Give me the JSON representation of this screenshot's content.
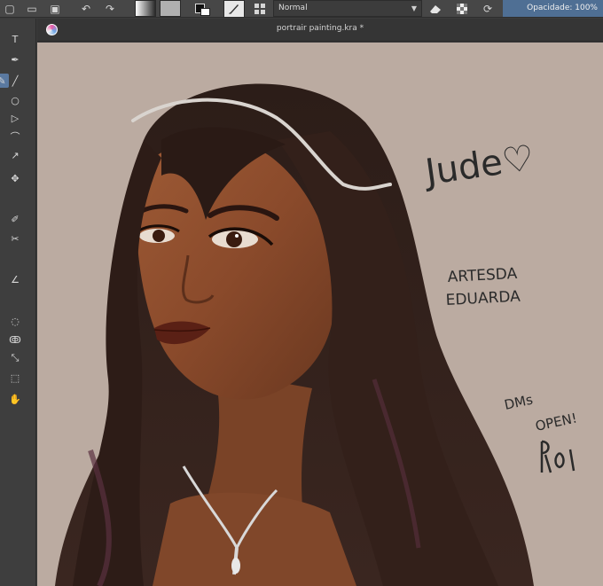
{
  "toolbar": {
    "icons": [
      "new-document-icon",
      "open-document-icon",
      "save-icon",
      "undo-icon",
      "redo-icon",
      "gradient-swatch-icon",
      "pattern-swatch-icon",
      "foreground-background-color-icon",
      "brush-preset-icon",
      "wrap-around-icon",
      "eraser-icon",
      "alpha-lock-icon",
      "reload-preset-icon"
    ],
    "blend_mode": "Normal",
    "opacity_label": "Opacidade:  100%"
  },
  "document": {
    "title": "portrair painting.kra *"
  },
  "canvas": {
    "background_color": "#bbaba1",
    "artwork": {
      "signature_lines": [
        "Jude♡"
      ],
      "artist_lines": [
        "ARTESDA",
        "EDUARDA"
      ],
      "dm_lines": [
        "DMs",
        "OPEN!"
      ]
    }
  }
}
